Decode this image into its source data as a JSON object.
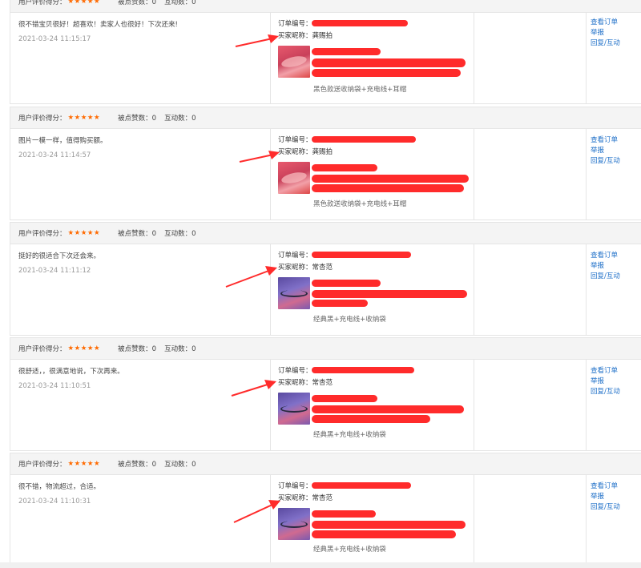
{
  "header": {
    "score_label": "用户评价得分：",
    "stars": "★★★★★",
    "likes_label": "被点赞数：",
    "interact_label": "互动数："
  },
  "labels": {
    "order_no": "订单编号：",
    "buyer_nick": "买家昵称："
  },
  "actions": {
    "view_order": "查看订单",
    "report": "举报",
    "reply": "回复/互动"
  },
  "colors": {
    "accent": "#1e6fc8",
    "star": "#ff6a00",
    "redact": "#ff2b2b"
  },
  "reviews": [
    {
      "likes": "0",
      "interactions": "0",
      "comment": "很不错宝贝很好！超喜欢！卖家人也很好！下次还来!",
      "time": "2021-03-24 11:15:17",
      "buyer": "龚赐拍",
      "sku": "黑色款送收纳袋+充电线+耳帽"
    },
    {
      "likes": "0",
      "interactions": "0",
      "comment": "图片一模一样，值得购买额。",
      "time": "2021-03-24 11:14:57",
      "buyer": "龚赐拍",
      "sku": "黑色款送收纳袋+充电线+耳帽"
    },
    {
      "likes": "0",
      "interactions": "0",
      "comment": "挺好的很适合下次还会来。",
      "time": "2021-03-24 11:11:12",
      "buyer": "常杏范",
      "sku": "经典黑+充电线+收纳袋"
    },
    {
      "likes": "0",
      "interactions": "0",
      "comment": "很舒适，，很满意地说，下次再来。",
      "time": "2021-03-24 11:10:51",
      "buyer": "常杏范",
      "sku": "经典黑+充电线+收纳袋"
    },
    {
      "likes": "0",
      "interactions": "0",
      "comment": "很不错，物流超过，合适。",
      "time": "2021-03-24 11:10:31",
      "buyer": "常杏范",
      "sku": "经典黑+充电线+收纳袋"
    }
  ]
}
